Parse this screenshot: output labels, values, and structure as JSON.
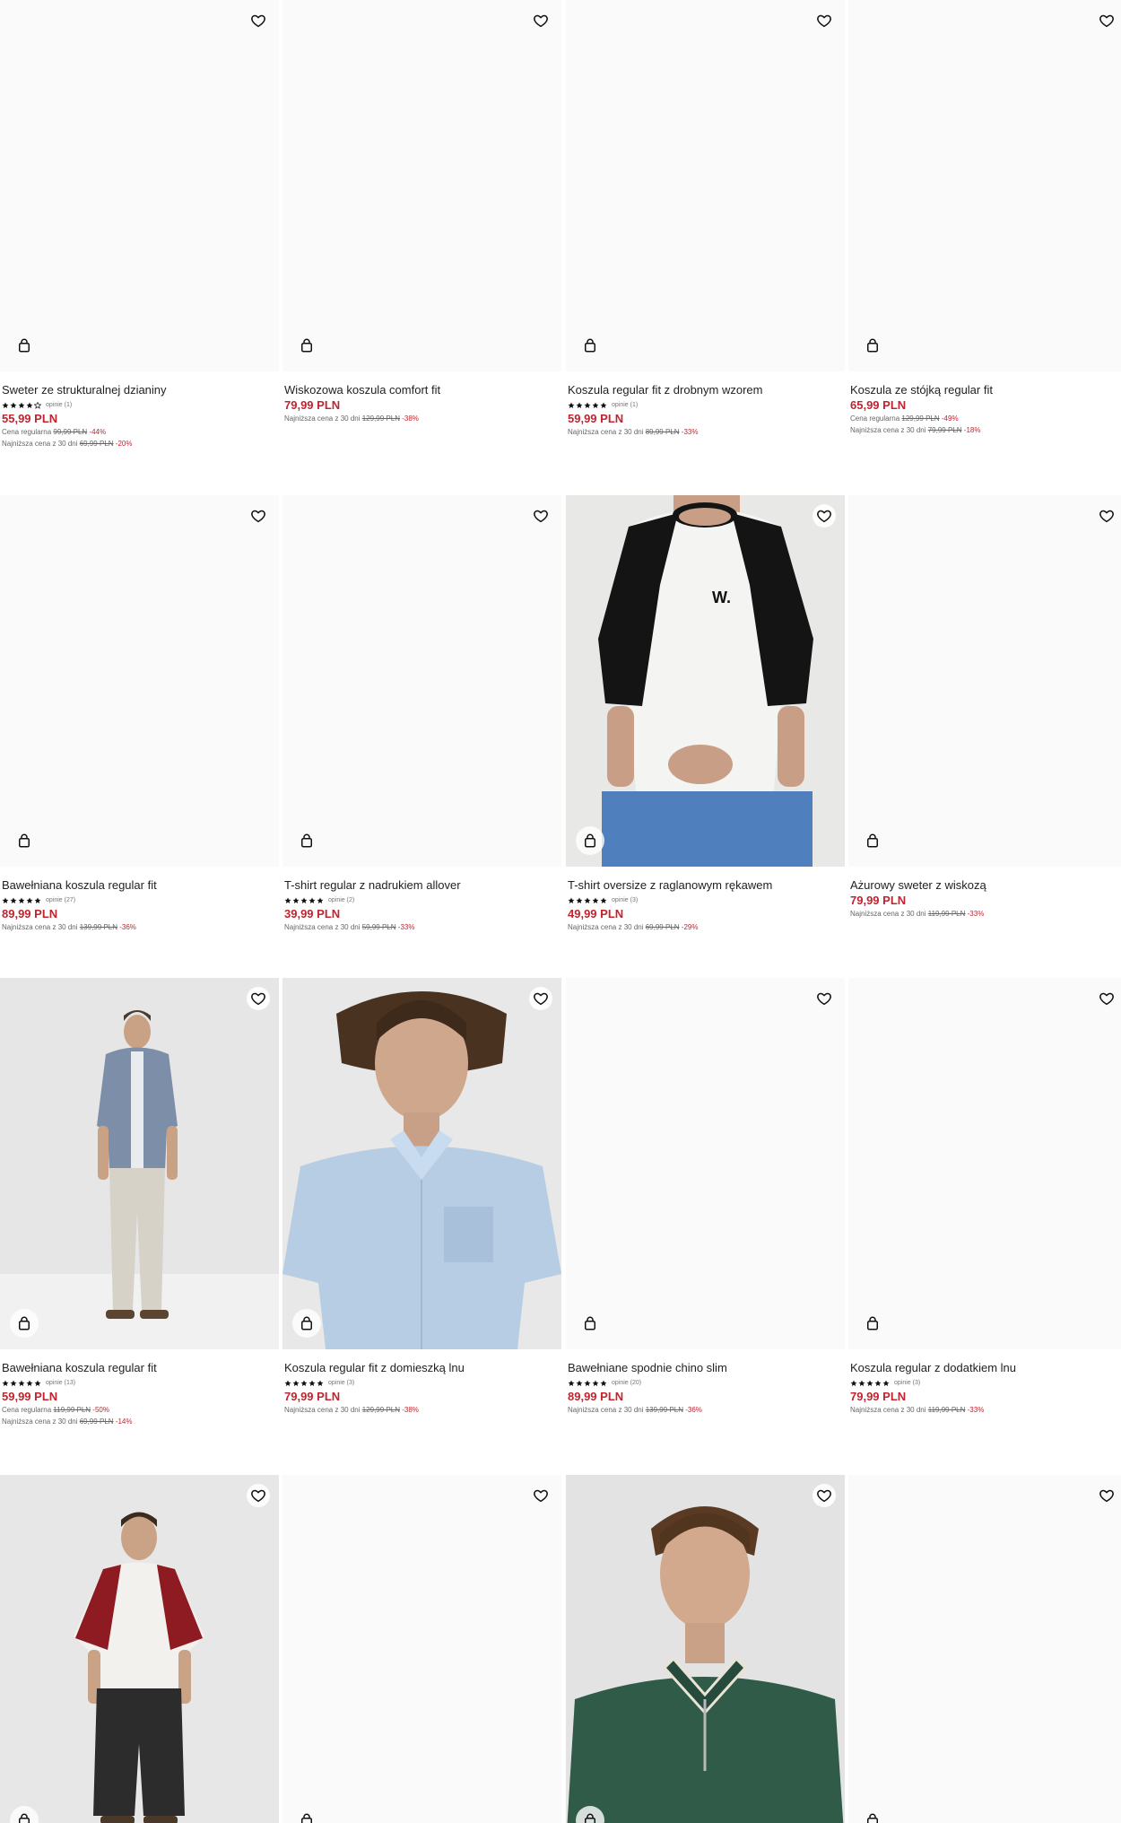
{
  "colors": {
    "price": "#c0242f",
    "text": "#222222",
    "muted": "#666666"
  },
  "icons": {
    "wishlist": "heart-outline-icon",
    "cart": "shopping-bag-icon",
    "rating": "star-icon"
  },
  "products": [
    {
      "name": "Sweter ze strukturalnej dzianiny",
      "rating": 4,
      "reviews": "opinie (1)",
      "price": "55,99 PLN",
      "lines": [
        {
          "label": "Cena regularna",
          "old": "99,99 PLN",
          "disc": "-44%"
        },
        {
          "label": "Najniższa cena z 30 dni",
          "old": "69,99 PLN",
          "disc": "-20%"
        }
      ],
      "photo": "none"
    },
    {
      "name": "Wiskozowa koszula comfort fit",
      "rating": null,
      "reviews": "",
      "price": "79,99 PLN",
      "lines": [
        {
          "label": "Najniższa cena z 30 dni",
          "old": "129,99 PLN",
          "disc": "-38%"
        }
      ],
      "photo": "none"
    },
    {
      "name": "Koszula regular fit z drobnym wzorem",
      "rating": 5,
      "reviews": "opinie (1)",
      "price": "59,99 PLN",
      "lines": [
        {
          "label": "Najniższa cena z 30 dni",
          "old": "89,99 PLN",
          "disc": "-33%"
        }
      ],
      "photo": "none"
    },
    {
      "name": "Koszula ze stójką regular fit",
      "rating": null,
      "reviews": "",
      "price": "65,99 PLN",
      "lines": [
        {
          "label": "Cena regularna",
          "old": "129,99 PLN",
          "disc": "-49%"
        },
        {
          "label": "Najniższa cena z 30 dni",
          "old": "79,99 PLN",
          "disc": "-18%"
        }
      ],
      "photo": "none"
    },
    {
      "name": "Bawełniana koszula regular fit",
      "rating": 5,
      "reviews": "opinie (27)",
      "price": "89,99 PLN",
      "lines": [
        {
          "label": "Najniższa cena z 30 dni",
          "old": "139,99 PLN",
          "disc": "-36%"
        }
      ],
      "photo": "none"
    },
    {
      "name": "T-shirt regular z nadrukiem allover",
      "rating": 5,
      "reviews": "opinie (2)",
      "price": "39,99 PLN",
      "lines": [
        {
          "label": "Najniższa cena z 30 dni",
          "old": "59,99 PLN",
          "disc": "-33%"
        }
      ],
      "photo": "none"
    },
    {
      "name": "T-shirt oversize z raglanowym rękawem",
      "rating": 5,
      "reviews": "opinie (3)",
      "price": "49,99 PLN",
      "lines": [
        {
          "label": "Najniższa cena z 30 dni",
          "old": "69,99 PLN",
          "disc": "-29%"
        }
      ],
      "photo": "raglan-tshirt",
      "logo": "W."
    },
    {
      "name": "Ażurowy sweter z wiskozą",
      "rating": null,
      "reviews": "",
      "price": "79,99 PLN",
      "lines": [
        {
          "label": "Najniższa cena z 30 dni",
          "old": "119,99 PLN",
          "disc": "-33%"
        }
      ],
      "photo": "none"
    },
    {
      "name": "Bawełniana koszula regular fit",
      "rating": 5,
      "reviews": "opinie (13)",
      "price": "59,99 PLN",
      "lines": [
        {
          "label": "Cena regularna",
          "old": "119,99 PLN",
          "disc": "-50%"
        },
        {
          "label": "Najniższa cena z 30 dni",
          "old": "69,99 PLN",
          "disc": "-14%"
        }
      ],
      "photo": "fullbody-chambray"
    },
    {
      "name": "Koszula regular fit z domieszką lnu",
      "rating": 5,
      "reviews": "opinie (3)",
      "price": "79,99 PLN",
      "lines": [
        {
          "label": "Najniższa cena z 30 dni",
          "old": "129,99 PLN",
          "disc": "-38%"
        }
      ],
      "photo": "linen-shirt"
    },
    {
      "name": "Bawełniane spodnie chino slim",
      "rating": 5,
      "reviews": "opinie (20)",
      "price": "89,99 PLN",
      "lines": [
        {
          "label": "Najniższa cena z 30 dni",
          "old": "139,99 PLN",
          "disc": "-36%"
        }
      ],
      "photo": "none"
    },
    {
      "name": "Koszula regular z dodatkiem lnu",
      "rating": 5,
      "reviews": "opinie (3)",
      "price": "79,99 PLN",
      "lines": [
        {
          "label": "Najniższa cena z 30 dni",
          "old": "119,99 PLN",
          "disc": "-33%"
        }
      ],
      "photo": "none"
    },
    {
      "name": "",
      "rating": null,
      "reviews": "",
      "price": "",
      "lines": [],
      "photo": "fullbody-raglan-red"
    },
    {
      "name": "",
      "rating": null,
      "reviews": "",
      "price": "",
      "lines": [],
      "photo": "none"
    },
    {
      "name": "",
      "rating": null,
      "reviews": "",
      "price": "",
      "lines": [],
      "photo": "green-polo"
    },
    {
      "name": "",
      "rating": null,
      "reviews": "",
      "price": "",
      "lines": [],
      "photo": "none"
    }
  ]
}
